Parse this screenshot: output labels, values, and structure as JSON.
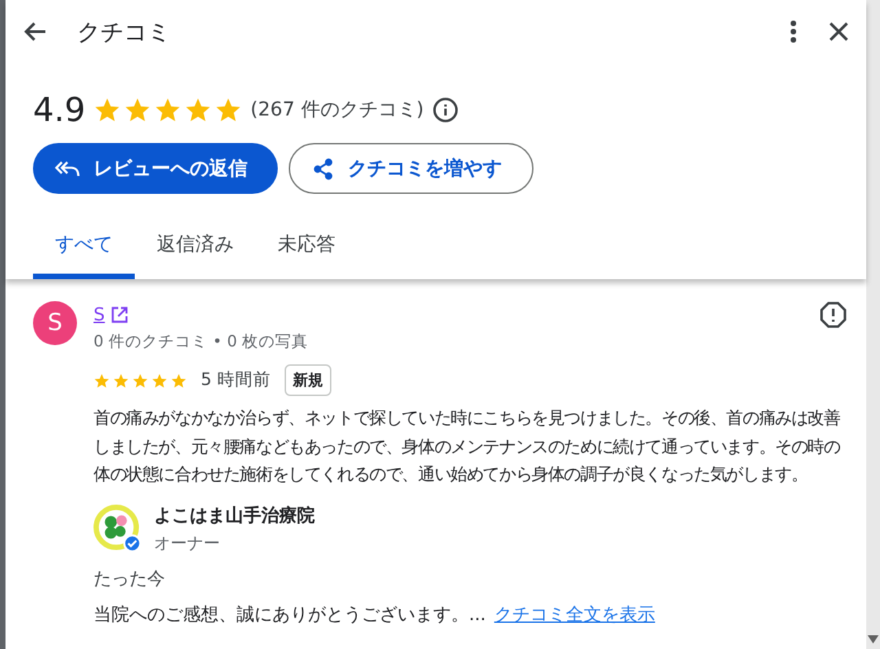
{
  "header": {
    "title": "クチコミ"
  },
  "summary": {
    "rating": "4.9",
    "stars": 5,
    "count": "(267 件のクチコミ)"
  },
  "buttons": [
    {
      "label": "レビューへの返信",
      "kind": "primary"
    },
    {
      "label": "クチコミを増やす",
      "kind": "outline"
    }
  ],
  "tabs": [
    {
      "label": "すべて",
      "selected": true
    },
    {
      "label": "返信済み",
      "selected": false
    },
    {
      "label": "未応答",
      "selected": false
    }
  ],
  "review": {
    "avatar_letter": "S",
    "author": "S",
    "meta": "0 件のクチコミ • 0 枚の写真",
    "stars": 5,
    "time": "5 時間前",
    "badge": "新規",
    "text": "首の痛みがなかなか治らず、ネットで探していた時にこちらを見つけました。その後、首の痛みは改善しましたが、元々腰痛などもあったので、身体のメンテナンスのために続けて通っています。その時の体の状態に合わせた施術をしてくれるので、通い始めてから身体の調子が良くなった気がします。",
    "reply": {
      "name": "よこはま山手治療院",
      "role": "オーナー",
      "time": "たった今",
      "text": "当院へのご感想、誠にありがとうございます。...",
      "more_link": "クチコミ全文を表示"
    }
  }
}
